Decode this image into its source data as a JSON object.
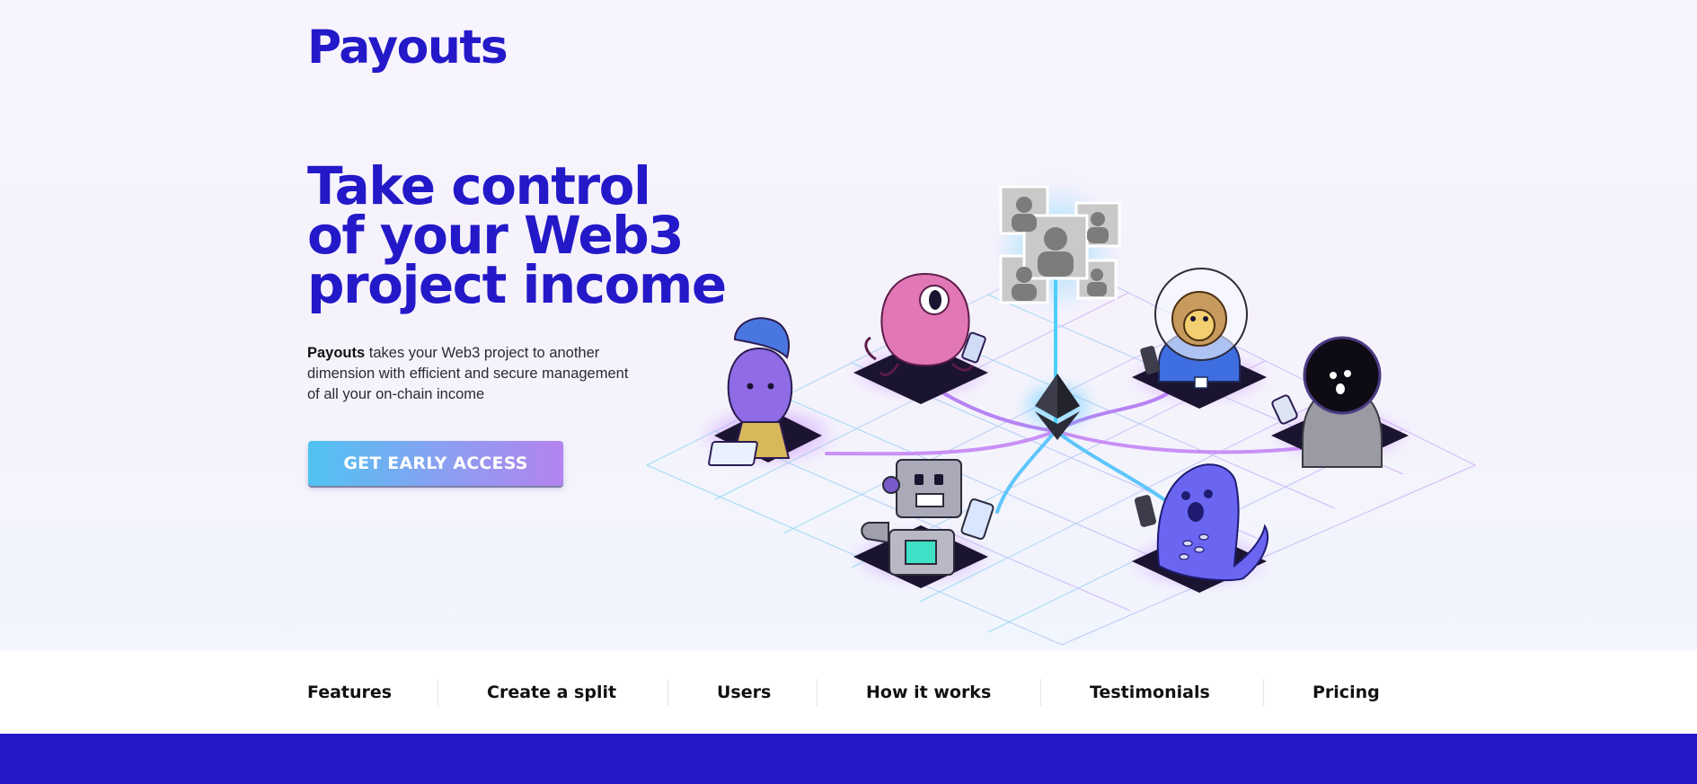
{
  "brand": {
    "name": "Payouts",
    "color": "#2419c8"
  },
  "hero": {
    "headline": [
      "Take control",
      "of your Web3",
      "project income"
    ],
    "description_strong": "Payouts",
    "description_rest": " takes your Web3 project to another dimension with efficient and secure management of all your on-chain income",
    "cta_label": "GET EARLY ACCESS"
  },
  "illustration": {
    "center_icon": "ethereum-icon",
    "nft_placeholder_icon": "user-silhouette-icon",
    "characters": [
      "alien-with-laptop",
      "pink-octopus",
      "monkey-astronaut",
      "hooded-figure",
      "robot-with-phone",
      "blue-blob"
    ]
  },
  "nav": {
    "tabs": [
      "Features",
      "Create a split",
      "Users",
      "How it works",
      "Testimonials",
      "Pricing"
    ]
  },
  "colors": {
    "accent": "#2419c8",
    "cta_start": "#4fc3f2",
    "cta_end": "#b483ef",
    "glow": "#3dc6ff"
  }
}
